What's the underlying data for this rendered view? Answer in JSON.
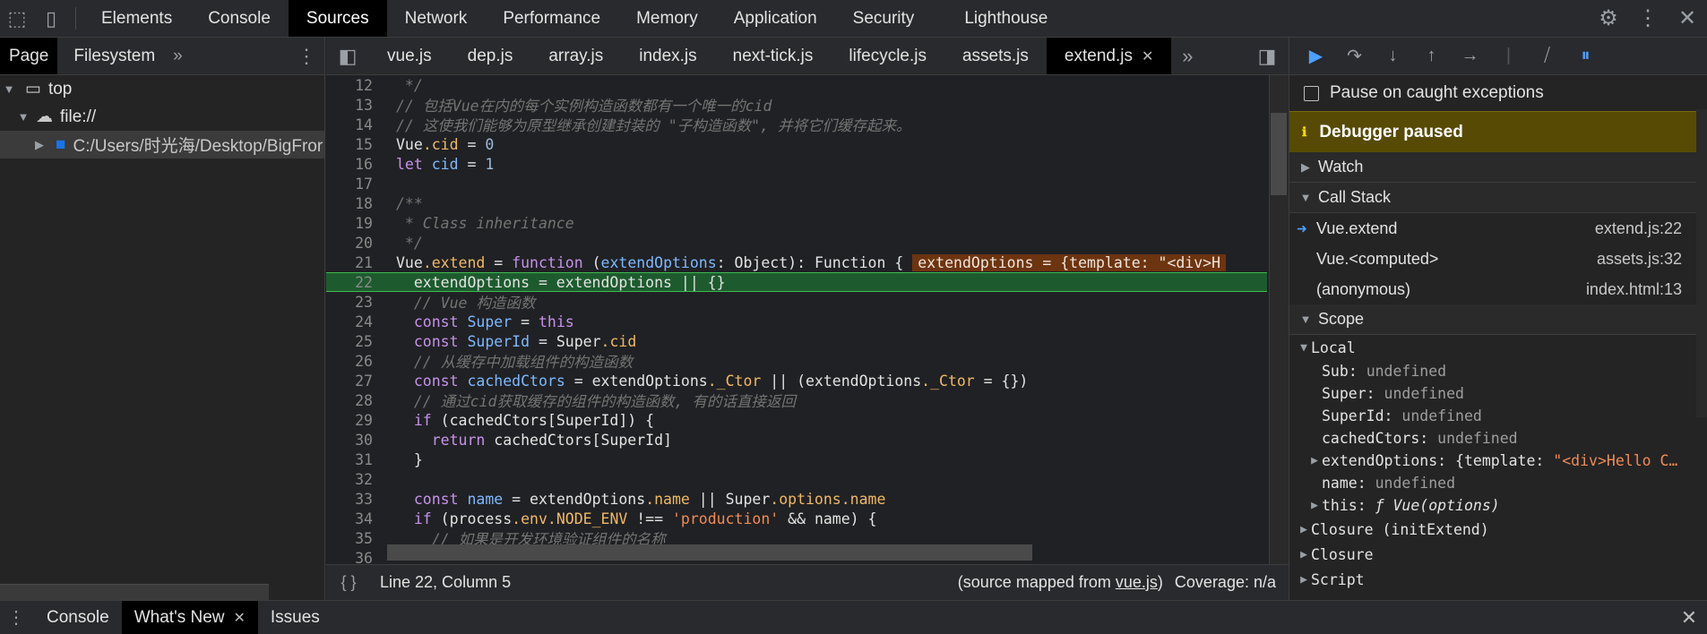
{
  "topbar": {
    "tabs": [
      "Elements",
      "Console",
      "Sources",
      "Network",
      "Performance",
      "Memory",
      "Application",
      "Security",
      "Lighthouse"
    ],
    "active": "Sources"
  },
  "navigator": {
    "tabs": [
      "Page",
      "Filesystem"
    ],
    "tree": {
      "top": "top",
      "origin": "file://",
      "folder": "C:/Users/时光海/Desktop/BigFror"
    }
  },
  "editor": {
    "tabs": [
      "vue.js",
      "dep.js",
      "array.js",
      "index.js",
      "next-tick.js",
      "lifecycle.js",
      "assets.js",
      "extend.js"
    ],
    "active_tab": "extend.js",
    "line_numbers": [
      "12",
      "13",
      "14",
      "15",
      "16",
      "17",
      "18",
      "19",
      "20",
      "21",
      "22",
      "23",
      "24",
      "25",
      "26",
      "27",
      "28",
      "29",
      "30",
      "31",
      "32",
      "33",
      "34",
      "35",
      "36"
    ],
    "lines": {
      "l12": " */",
      "l13": "// 包括Vue在内的每个实例构造函数都有一个唯一的cid",
      "l14": "// 这使我们能够为原型继承创建封装的 \"子构造函数\", 并将它们缓存起来。",
      "l15a": "Vue",
      "l15b": ".cid",
      "l15c": " = ",
      "l15d": "0",
      "l16a": "let ",
      "l16b": "cid",
      "l16c": " = ",
      "l16d": "1",
      "l18": "/**",
      "l19": " * Class inheritance",
      "l20": " */",
      "l21a": "Vue",
      "l21b": ".extend",
      "l21c": " = ",
      "l21d": "function",
      "l21e": " (",
      "l21f": "extendOptions",
      "l21g": ": Object): Function {",
      "l21inline": "extendOptions = {template: \"<div>H",
      "l22": "  extendOptions = extendOptions || {}",
      "l23": "  // Vue 构造函数",
      "l24a": "  const ",
      "l24b": "Super",
      "l24c": " = ",
      "l24d": "this",
      "l25a": "  const ",
      "l25b": "SuperId",
      "l25c": " = Super",
      "l25d": ".cid",
      "l26": "  // 从缓存中加载组件的构造函数",
      "l27a": "  const ",
      "l27b": "cachedCtors",
      "l27c": " = extendOptions",
      "l27d": "._Ctor",
      "l27e": " || (extendOptions",
      "l27f": "._Ctor",
      "l27g": " = {})",
      "l28": "  // 通过cid获取缓存的组件的构造函数, 有的话直接返回",
      "l29a": "  if",
      "l29b": " (cachedCtors[SuperId]) {",
      "l30a": "    return",
      "l30b": " cachedCtors[SuperId]",
      "l31": "  }",
      "l33a": "  const ",
      "l33b": "name",
      "l33c": " = extendOptions",
      "l33d": ".name",
      "l33e": " || Super",
      "l33f": ".options",
      "l33g": ".name",
      "l34a": "  if",
      "l34b": " (process",
      "l34c": ".env",
      "l34d": ".NODE_ENV",
      "l34e": " !== ",
      "l34f": "'production'",
      "l34g": " && name) {",
      "l35": "    // 如果是开发环境验证组件的名称"
    },
    "status": {
      "position": "Line 22, Column 5",
      "mapped_prefix": "(source mapped from ",
      "mapped_file": "vue.js",
      "mapped_suffix": ")",
      "coverage": "Coverage: n/a"
    }
  },
  "debugger": {
    "pause_on_exceptions": "Pause on caught exceptions",
    "paused_label": "Debugger paused",
    "sections": {
      "watch": "Watch",
      "call_stack": "Call Stack",
      "scope": "Scope"
    },
    "call_stack": [
      {
        "fn": "Vue.extend",
        "loc": "extend.js:22"
      },
      {
        "fn": "Vue.<computed>",
        "loc": "assets.js:32"
      },
      {
        "fn": "(anonymous)",
        "loc": "index.html:13"
      }
    ],
    "scope": {
      "local_label": "Local",
      "sub_k": "Sub",
      "sub_v": "undefined",
      "super_k": "Super",
      "super_v": "undefined",
      "superid_k": "SuperId",
      "superid_v": "undefined",
      "cached_k": "cachedCtors",
      "cached_v": "undefined",
      "opts_k": "extendOptions",
      "opts_v1": "{template: ",
      "opts_v2": "\"<div>Hello C…",
      "name_k": "name",
      "name_v": "undefined",
      "this_k": "this",
      "this_v": "ƒ Vue(options)",
      "closure1": "Closure (initExtend)",
      "closure2": "Closure",
      "script": "Script"
    }
  },
  "drawer": {
    "tabs": [
      "Console",
      "What's New",
      "Issues"
    ],
    "active": "What's New"
  },
  "colors": {
    "paused_bg": "#574a05",
    "exec_line_bg": "#1d5b2e",
    "accent_blue": "#4d9fff"
  }
}
